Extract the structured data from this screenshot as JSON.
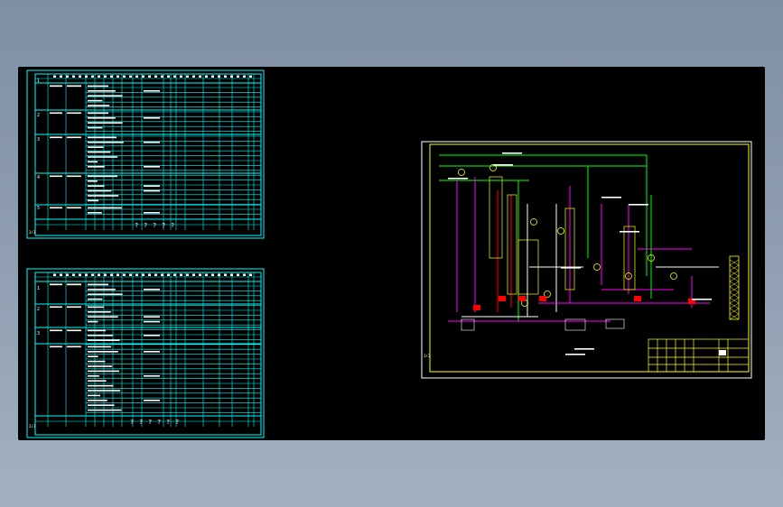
{
  "view": {
    "background_color": "#8e9db1",
    "model_space_color": "#000000"
  },
  "colors": {
    "table_line": "#00ffff",
    "table_text": "#ffffff",
    "frame": "#ffff00",
    "pipe_green": "#00ff00",
    "pipe_magenta": "#ff00ff",
    "pipe_red": "#ff0000",
    "equipment_yellow": "#ffff00",
    "pipe_white": "#ffffff"
  },
  "sheet1": {
    "corner_label": "3/3",
    "row_numbers": [
      "1",
      "2",
      "3",
      "4",
      "5"
    ],
    "footer_marks": [
      "?",
      "?",
      "?",
      "?",
      "?"
    ]
  },
  "sheet2": {
    "corner_label": "2/3",
    "row_numbers": [
      "1",
      "2",
      "3"
    ],
    "footer_marks": [
      "?",
      "?",
      "?",
      "?",
      "?",
      "?"
    ]
  },
  "sheet3": {
    "corner_label": "1/3",
    "icons": [
      "process-flow-diagram"
    ]
  }
}
